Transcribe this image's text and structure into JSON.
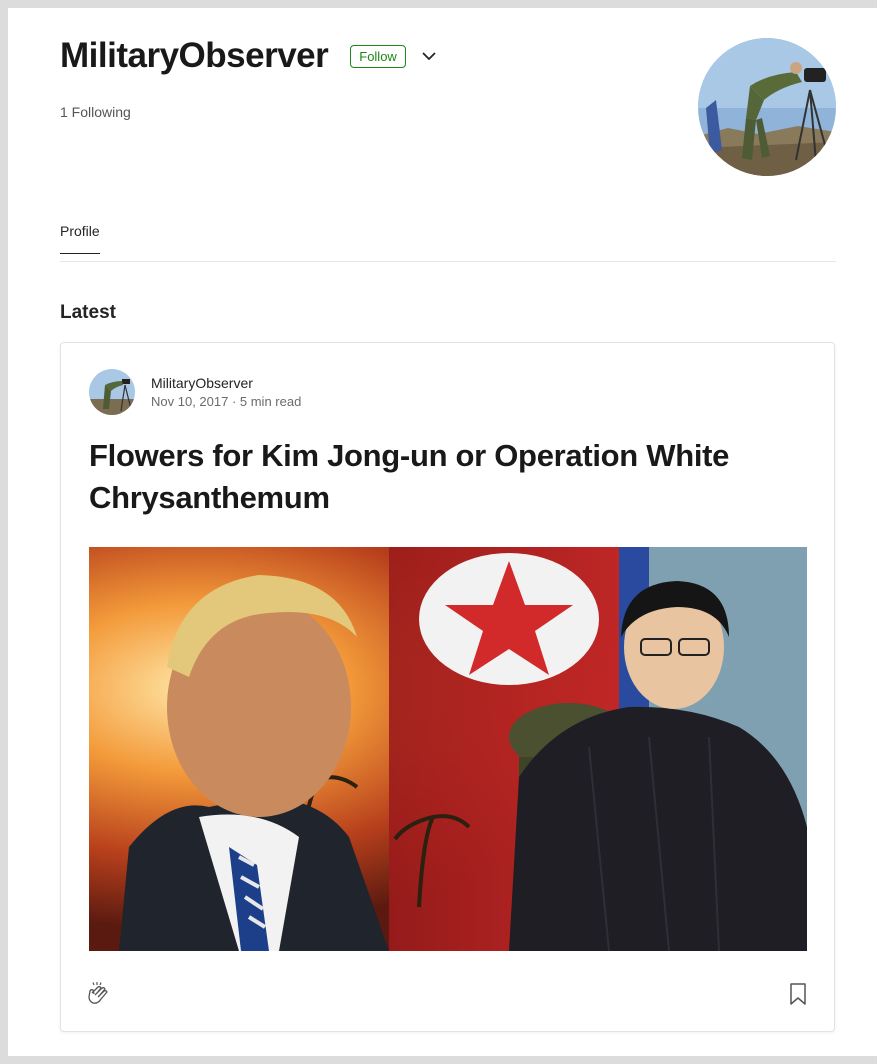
{
  "profile": {
    "name": "MilitaryObserver",
    "follow_label": "Follow",
    "following_text": "1 Following"
  },
  "tabs": {
    "profile_label": "Profile"
  },
  "section": {
    "latest_label": "Latest"
  },
  "post": {
    "author": "MilitaryObserver",
    "meta": "Nov 10, 2017 · 5 min read",
    "title": "Flowers for Kim Jong-un or Operation White Chrysanthemum"
  },
  "colors": {
    "accent_green": "#1a8917",
    "text_primary": "#242424",
    "text_secondary": "#6b6b6b"
  },
  "icons": {
    "chevron": "chevron-down-icon",
    "clap": "clap-icon",
    "bookmark": "bookmark-icon"
  }
}
